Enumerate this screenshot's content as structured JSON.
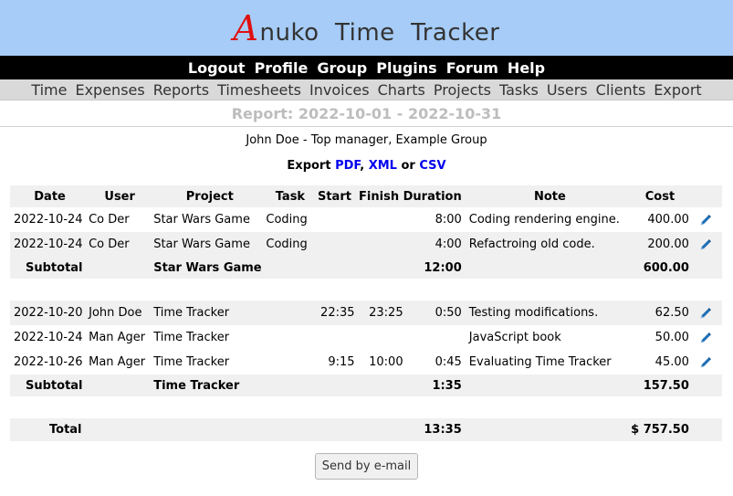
{
  "app": {
    "logo_letter": "A",
    "logo_rest": "nuko  Time  Tracker"
  },
  "topnav": [
    "Logout",
    "Profile",
    "Group",
    "Plugins",
    "Forum",
    "Help"
  ],
  "menu": [
    "Time",
    "Expenses",
    "Reports",
    "Timesheets",
    "Invoices",
    "Charts",
    "Projects",
    "Tasks",
    "Users",
    "Clients",
    "Export"
  ],
  "report": {
    "title": "Report: 2022-10-01 - 2022-10-31",
    "subtitle": "John Doe - Top manager, Example Group",
    "export_prefix": "Export",
    "export_pdf": "PDF",
    "export_sep1": ",",
    "export_xml": "XML",
    "export_or": "or",
    "export_csv": "CSV"
  },
  "table": {
    "headers": {
      "date": "Date",
      "user": "User",
      "project": "Project",
      "task": "Task",
      "start": "Start",
      "finish": "Finish",
      "duration": "Duration",
      "note": "Note",
      "cost": "Cost"
    },
    "group1": [
      {
        "date": "2022-10-24",
        "user": "Co Der",
        "project": "Star Wars Game",
        "task": "Coding",
        "start": "",
        "finish": "",
        "duration": "8:00",
        "note": "Coding rendering engine.",
        "cost": "400.00"
      },
      {
        "date": "2022-10-24",
        "user": "Co Der",
        "project": "Star Wars Game",
        "task": "Coding",
        "start": "",
        "finish": "",
        "duration": "4:00",
        "note": "Refactroing old code.",
        "cost": "200.00"
      }
    ],
    "subtotal1": {
      "label": "Subtotal",
      "project": "Star Wars Game",
      "duration": "12:00",
      "cost": "600.00"
    },
    "group2": [
      {
        "date": "2022-10-20",
        "user": "John Doe",
        "project": "Time Tracker",
        "task": "",
        "start": "22:35",
        "finish": "23:25",
        "duration": "0:50",
        "note": "Testing modifications.",
        "cost": "62.50"
      },
      {
        "date": "2022-10-24",
        "user": "Man Ager",
        "project": "Time Tracker",
        "task": "",
        "start": "",
        "finish": "",
        "duration": "",
        "note": "JavaScript book",
        "cost": "50.00"
      },
      {
        "date": "2022-10-26",
        "user": "Man Ager",
        "project": "Time Tracker",
        "task": "",
        "start": "9:15",
        "finish": "10:00",
        "duration": "0:45",
        "note": "Evaluating Time Tracker",
        "cost": "45.00"
      }
    ],
    "subtotal2": {
      "label": "Subtotal",
      "project": "Time Tracker",
      "duration": "1:35",
      "cost": "157.50"
    },
    "total": {
      "label": "Total",
      "duration": "13:35",
      "cost": "$ 757.50"
    }
  },
  "send_button": "Send by e-mail",
  "colors": {
    "header_bg": "#a6ccf7",
    "logo_accent": "#e01010",
    "link": "#0000ee",
    "pencil": "#1f6fb5"
  }
}
